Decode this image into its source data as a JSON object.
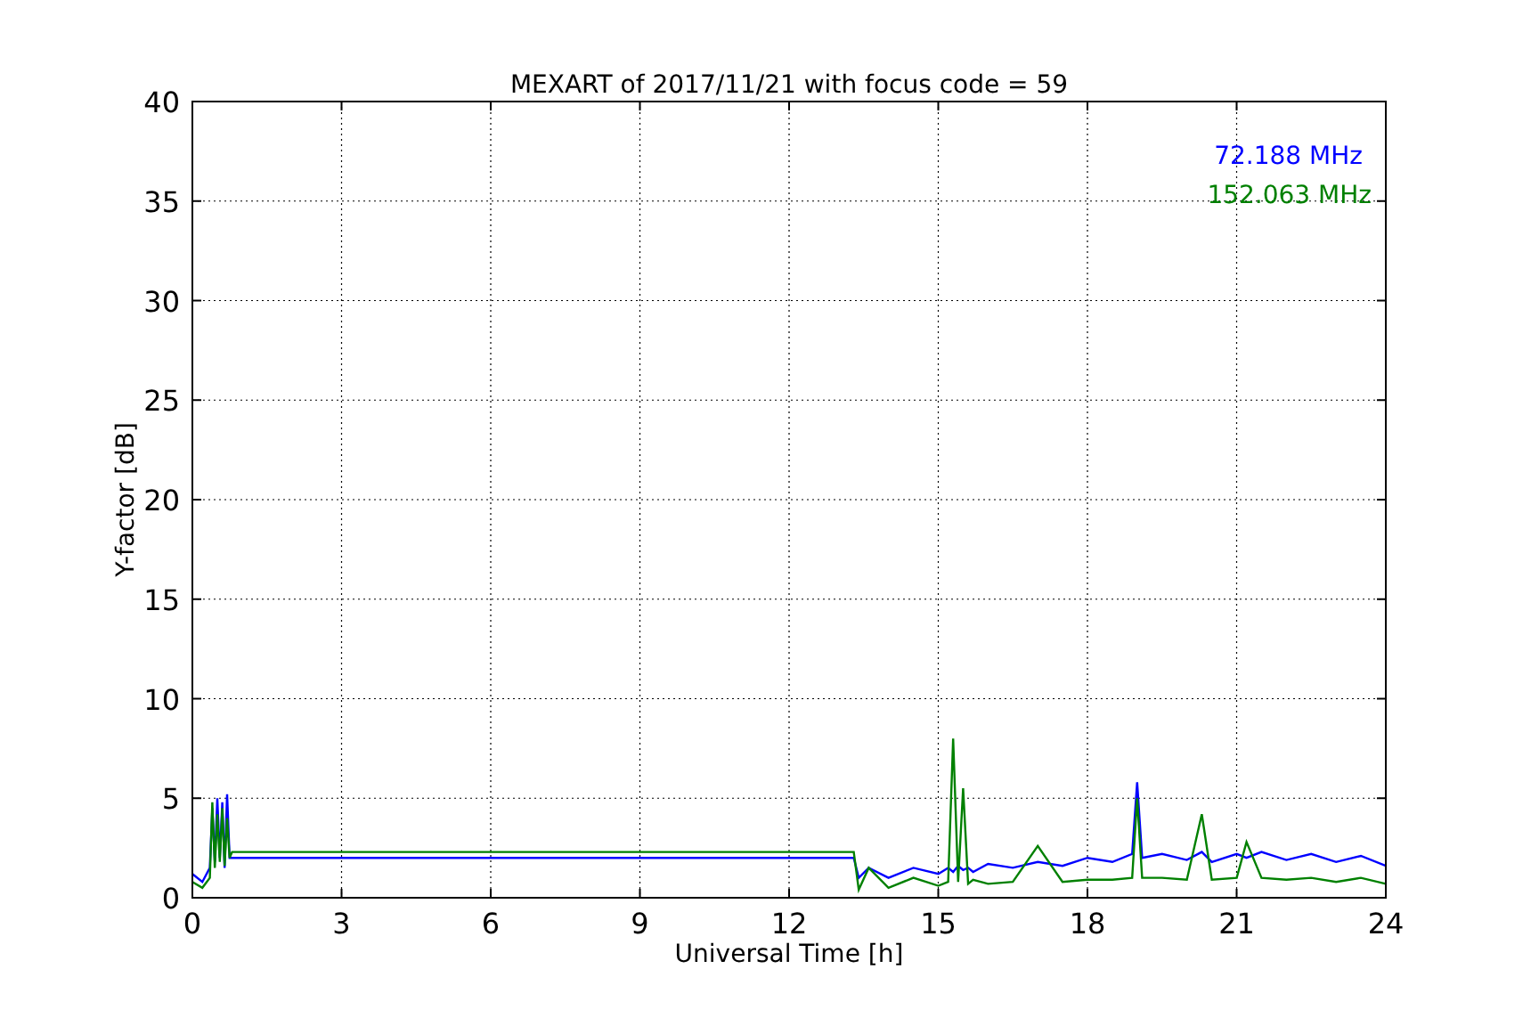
{
  "chart_data": {
    "type": "line",
    "title": "MEXART of 2017/11/21 with focus code = 59",
    "xlabel": "Universal Time [h]",
    "ylabel": "Y-factor [dB]",
    "x": [
      0,
      0.2,
      0.35,
      0.4,
      0.45,
      0.5,
      0.55,
      0.6,
      0.65,
      0.7,
      0.75,
      0.8,
      13.3,
      13.4,
      13.6,
      14,
      14.5,
      15,
      15.2,
      15.3,
      15.4,
      15.5,
      15.6,
      15.7,
      16,
      16.5,
      17,
      17.5,
      18,
      18.5,
      18.9,
      19,
      19.1,
      19.5,
      20,
      20.3,
      20.5,
      21,
      21.2,
      21.5,
      22,
      22.5,
      23,
      23.5,
      24
    ],
    "series": [
      {
        "name": "72.188 MHz",
        "color": "#0000ff",
        "values": [
          1.2,
          0.8,
          1.5,
          4.5,
          1.8,
          5,
          2,
          4.8,
          1.5,
          5.2,
          2,
          2,
          2,
          1,
          1.5,
          1,
          1.5,
          1.2,
          1.5,
          1.3,
          1.6,
          1.4,
          1.5,
          1.3,
          1.7,
          1.5,
          1.8,
          1.6,
          2,
          1.8,
          2.2,
          5.8,
          2,
          2.2,
          1.9,
          2.3,
          1.8,
          2.2,
          2,
          2.3,
          1.9,
          2.2,
          1.8,
          2.1,
          1.6
        ]
      },
      {
        "name": "152.063 MHz",
        "color": "#008000",
        "values": [
          0.8,
          0.5,
          1,
          4.8,
          1.5,
          4.2,
          1.8,
          4.5,
          1.6,
          4,
          2,
          2.3,
          2.3,
          0.4,
          1.5,
          0.5,
          1,
          0.6,
          0.8,
          8,
          0.8,
          5.5,
          0.7,
          0.9,
          0.7,
          0.8,
          2.6,
          0.8,
          0.9,
          0.9,
          1,
          5,
          1,
          1,
          0.9,
          4.2,
          0.9,
          1,
          2.8,
          1,
          0.9,
          1,
          0.8,
          1,
          0.7
        ]
      }
    ],
    "xlim": [
      0,
      24
    ],
    "ylim": [
      0,
      40
    ],
    "xticks": [
      0,
      3,
      6,
      9,
      12,
      15,
      18,
      21,
      24
    ],
    "yticks": [
      0,
      5,
      10,
      15,
      20,
      25,
      30,
      35,
      40
    ],
    "grid": true
  }
}
